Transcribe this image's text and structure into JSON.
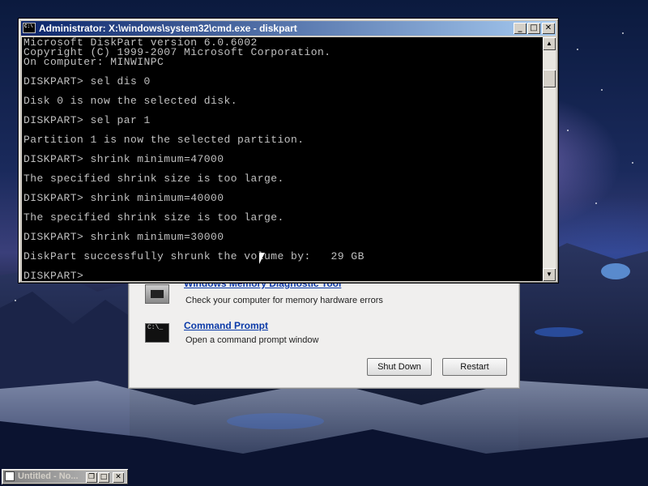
{
  "cmd_window": {
    "title": "Administrator: X:\\windows\\system32\\cmd.exe - diskpart",
    "icon_text": "C:\\",
    "minimize_label": "_",
    "maximize_label": "□",
    "close_label": "✕",
    "console_text": "Microsoft DiskPart version 6.0.6002\nCopyright (C) 1999-2007 Microsoft Corporation.\nOn computer: MINWINPC\n\nDISKPART> sel dis 0\n\nDisk 0 is now the selected disk.\n\nDISKPART> sel par 1\n\nPartition 1 is now the selected partition.\n\nDISKPART> shrink minimum=47000\n\nThe specified shrink size is too large.\n\nDISKPART> shrink minimum=40000\n\nThe specified shrink size is too large.\n\nDISKPART> shrink minimum=30000\n\nDiskPart successfully shrunk the volume by:   29 GB\n\nDISKPART>"
  },
  "recovery_window": {
    "items": [
      {
        "link": "Windows Memory Diagnostic Tool",
        "description": "Check your computer for memory hardware errors",
        "icon": "memory-chip-icon"
      },
      {
        "link": "Command Prompt",
        "description": "Open a command prompt window",
        "icon": "command-prompt-icon",
        "icon_text": "C:\\_"
      }
    ],
    "shutdown_label": "Shut Down",
    "restart_label": "Restart"
  },
  "minimized_window": {
    "title": "Untitled - No..."
  }
}
